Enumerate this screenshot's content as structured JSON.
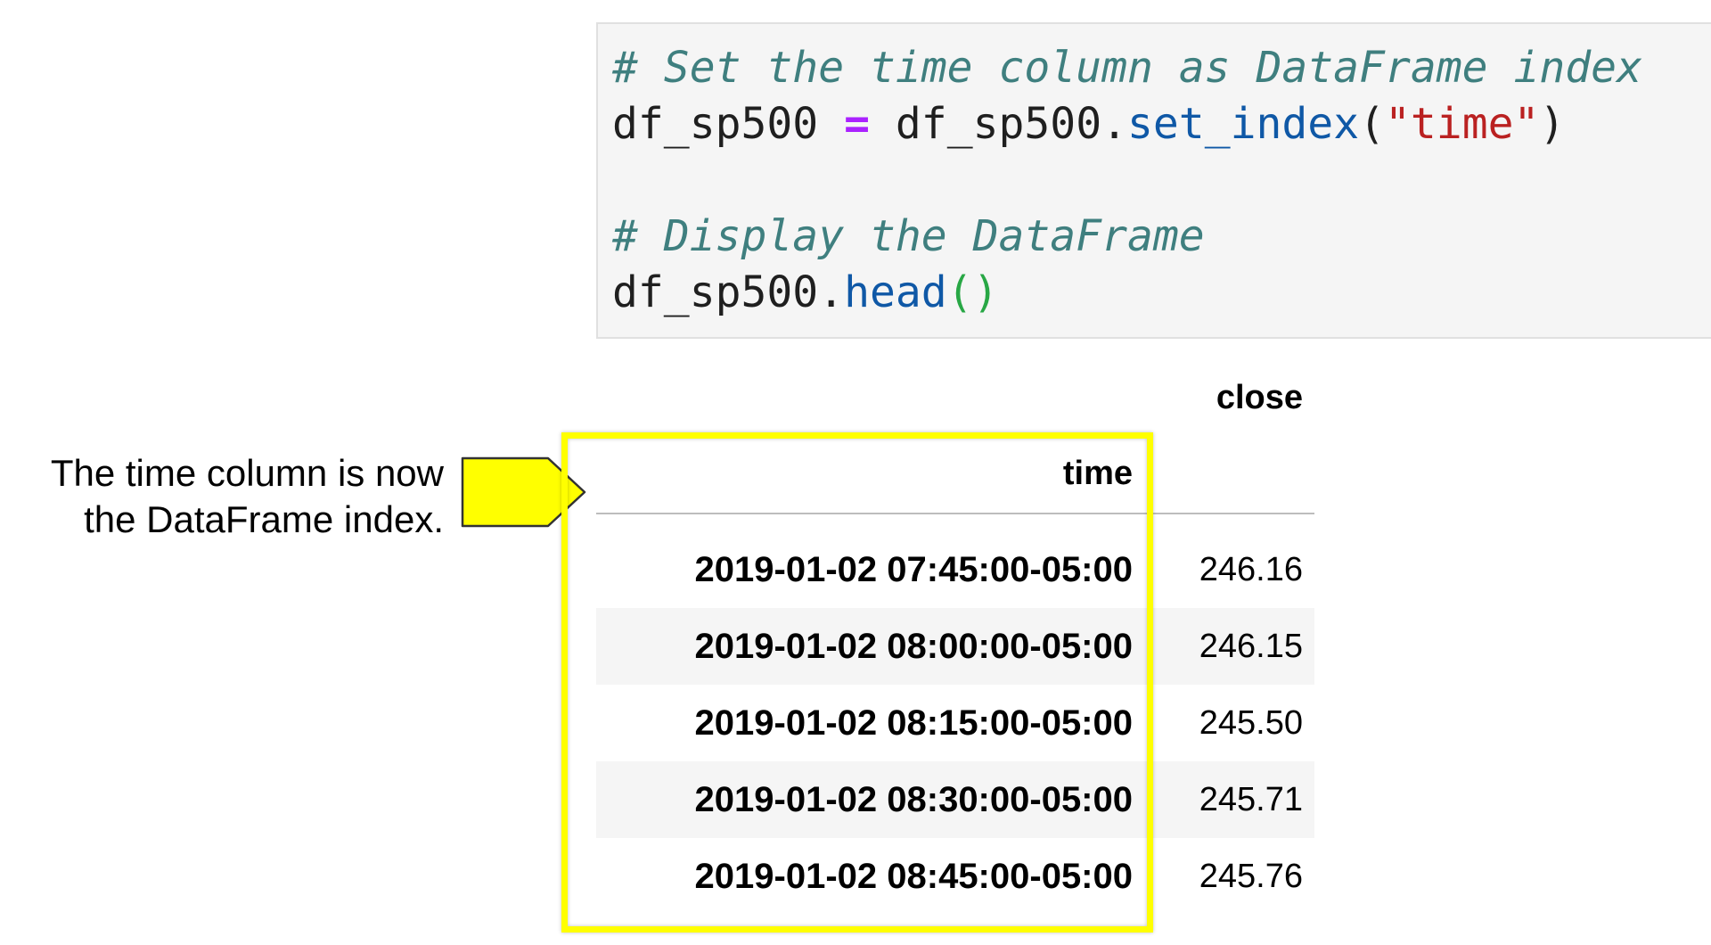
{
  "code_cell": {
    "line1": "# Set the time column as DataFrame index",
    "line2_var": "df_sp500",
    "line2_op": "=",
    "line2_obj": "df_sp500.",
    "line2_method": "set_index",
    "line2_open": "(",
    "line2_arg": "\"time\"",
    "line2_close": ")",
    "line4": "# Display the DataFrame",
    "line5_obj": "df_sp500.",
    "line5_method": "head",
    "line5_parens": "()"
  },
  "annotation": {
    "line1": "The time column is now",
    "line2": "the DataFrame index."
  },
  "dataframe": {
    "column_header": "close",
    "index_header": "time",
    "rows": [
      {
        "index": "2019-01-02 07:45:00-05:00",
        "close": "246.16"
      },
      {
        "index": "2019-01-02 08:00:00-05:00",
        "close": "246.15"
      },
      {
        "index": "2019-01-02 08:15:00-05:00",
        "close": "245.50"
      },
      {
        "index": "2019-01-02 08:30:00-05:00",
        "close": "245.71"
      },
      {
        "index": "2019-01-02 08:45:00-05:00",
        "close": "245.76"
      }
    ]
  },
  "colors": {
    "highlight": "#ffff00",
    "comment": "#3f7f7f",
    "method": "#0f58a6",
    "string": "#ba2121",
    "operator": "#aa22ff"
  }
}
